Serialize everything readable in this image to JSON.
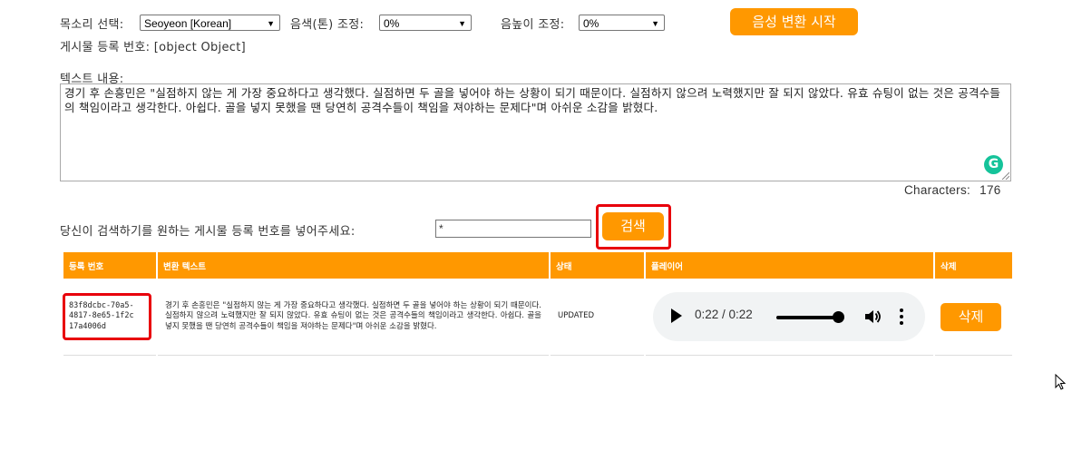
{
  "controls": {
    "voice_label": "목소리 선택:",
    "voice_value": "Seoyeon [Korean]",
    "tone_label": "음색(톤) 조정:",
    "tone_value": "0%",
    "pitch_label": "음높이 조정:",
    "pitch_value": "0%",
    "start_button": "음성 변환 시작",
    "post_number_line": "게시물 등록 번호: [object Object]"
  },
  "text_area": {
    "label": "텍스트 내용:",
    "value": "경기 후 손흥민은 \"실점하지 않는 게 가장 중요하다고 생각했다. 실점하면 두 골을 넣어야 하는 상황이 되기 때문이다. 실점하지 않으려 노력했지만 잘 되지 않았다. 유효 슈팅이 없는 것은 공격수들의 책임이라고 생각한다. 아쉽다. 골을 넣지 못했을 땐 당연히 공격수들이 책임을 져야하는 문제다\"며 아쉬운 소감을 밝혔다.",
    "char_count_label": "Characters:",
    "char_count": "176",
    "grammarly_icon": "grammarly-icon"
  },
  "search": {
    "label": "당신이 검색하기를 원하는 게시물 등록 번호를 넣어주세요:",
    "input_value": "*",
    "button": "검색"
  },
  "table": {
    "headers": [
      "등록 번호",
      "변환 텍스트",
      "상태",
      "플레이어",
      "삭제"
    ],
    "rows": [
      {
        "id": "83f8dcbc-70a5-4817-8e65-1f2c17a4006d",
        "text": "경기 후 손흥민은 \"실점하지 않는 게 가장 중요하다고 생각했다. 실점하면 두 골을 넣어야 하는 상황이 되기 때문이다. 실점하지 않으려 노력했지만 잘 되지 않았다. 유효 슈팅이 없는 것은 공격수들의 책임이라고 생각한다. 아쉽다. 골을 넣지 못했을 땐 당연히 공격수들이 책임을 져야하는 문제다\"며 아쉬운 소감을 밝혔다.",
        "status": "UPDATED",
        "player_time": "0:22 /  0:22",
        "player_progress": 1.0,
        "delete": "삭제"
      }
    ]
  },
  "colors": {
    "accent": "#ff9800",
    "highlight": "#e8000b",
    "grammarly": "#15c39a"
  }
}
